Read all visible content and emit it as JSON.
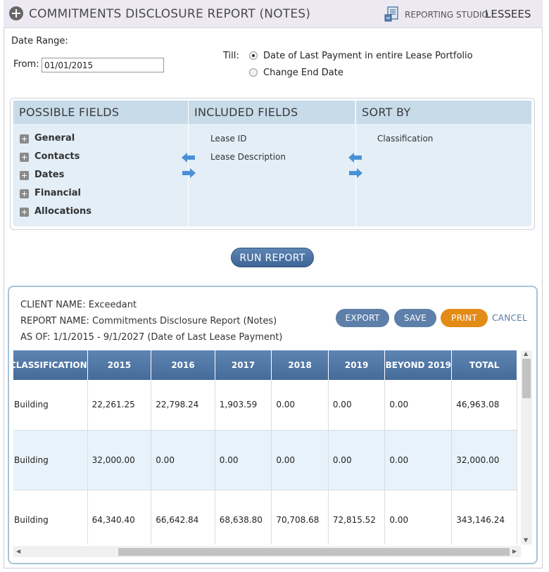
{
  "header": {
    "title": "COMMITMENTS DISCLOSURE REPORT (NOTES)",
    "studio_small": "REPORTING STUDIO",
    "studio_big": "LESSEES"
  },
  "date_range": {
    "label": "Date Range:",
    "from_label": "From:",
    "from_value": "01/01/2015",
    "till_label": "Till:",
    "options": [
      {
        "label": "Date of Last Payment in entire Lease Portfolio",
        "selected": true
      },
      {
        "label": "Change End Date",
        "selected": false
      }
    ]
  },
  "fields": {
    "possible_header": "POSSIBLE FIELDS",
    "included_header": "INCLUDED FIELDS",
    "sort_header": "SORT BY",
    "possible": [
      "General",
      "Contacts",
      "Dates",
      "Financial",
      "Allocations"
    ],
    "included": [
      "Lease ID",
      "Lease Description"
    ],
    "sort": [
      "Classification"
    ]
  },
  "run_button": "RUN REPORT",
  "report": {
    "client": "CLIENT NAME: Exceedant",
    "name": "REPORT NAME: Commitments Disclosure Report (Notes)",
    "as_of": "AS OF: 1/1/2015 - 9/1/2027  (Date of Last Lease Payment)",
    "export": "EXPORT",
    "save": "SAVE",
    "print": "PRINT",
    "cancel": "CANCEL"
  },
  "table": {
    "columns": [
      "CLASSIFICATION",
      "2015",
      "2016",
      "2017",
      "2018",
      "2019",
      "BEYOND 2019",
      "TOTAL"
    ],
    "rows": [
      [
        "Building",
        "22,261.25",
        "22,798.24",
        "1,903.59",
        "0.00",
        "0.00",
        "0.00",
        "46,963.08"
      ],
      [
        "Building",
        "32,000.00",
        "0.00",
        "0.00",
        "0.00",
        "0.00",
        "0.00",
        "32,000.00"
      ],
      [
        "Building",
        "64,340.40",
        "66,642.84",
        "68,638.80",
        "70,708.68",
        "72,815.52",
        "0.00",
        "343,146.24"
      ]
    ]
  },
  "colors": {
    "header_bg": "#ede9f3",
    "panel_bg": "#e3eef7",
    "accent_blue": "#5d7fa9",
    "print_orange": "#e38b17"
  }
}
